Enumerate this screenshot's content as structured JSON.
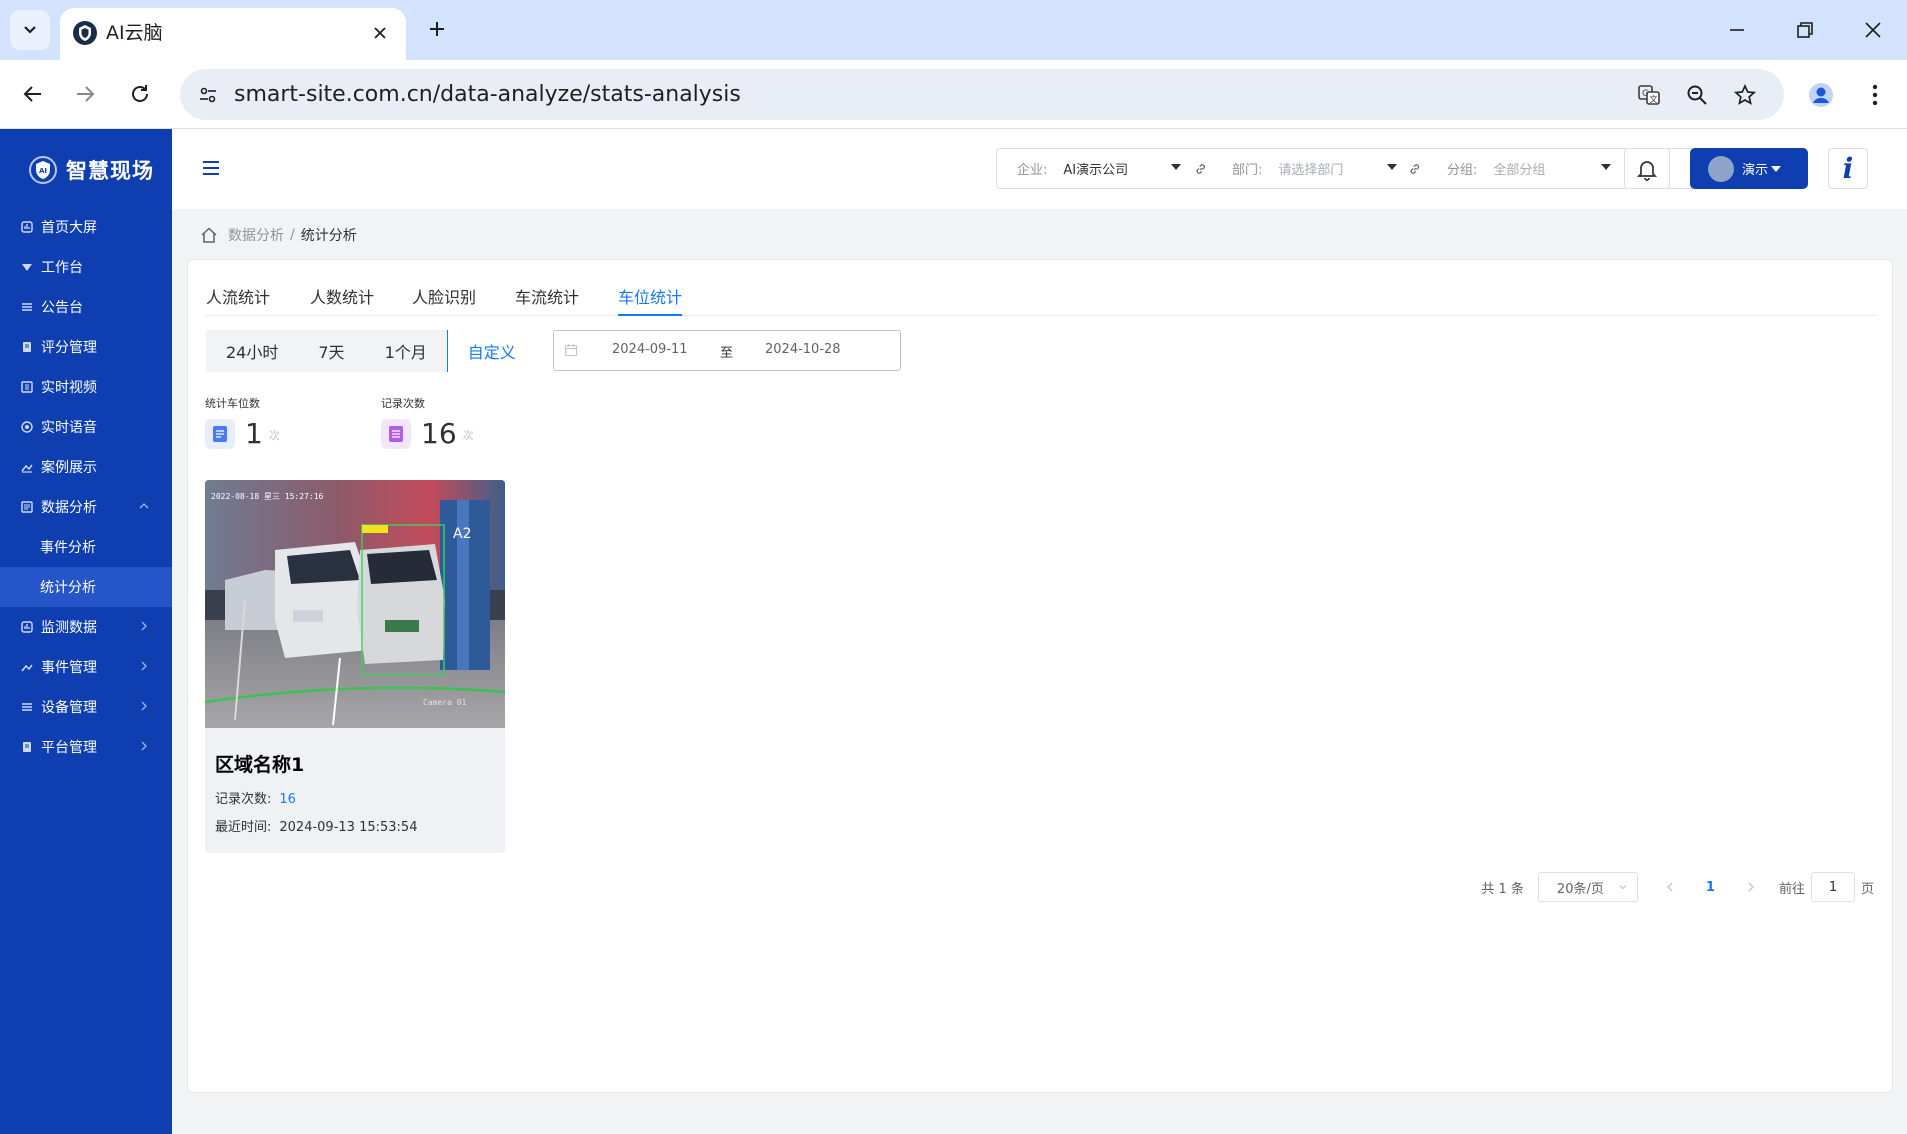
{
  "browser": {
    "tab_title": "AI云脑",
    "url": "smart-site.com.cn/data-analyze/stats-analysis"
  },
  "sidebar": {
    "brand": "智慧现场",
    "items": [
      {
        "label": "首页大屏",
        "icon": "dashboard-icon"
      },
      {
        "label": "工作台",
        "icon": "workbench-icon"
      },
      {
        "label": "公告台",
        "icon": "announcement-icon"
      },
      {
        "label": "评分管理",
        "icon": "score-icon"
      },
      {
        "label": "实时视频",
        "icon": "video-icon"
      },
      {
        "label": "实时语音",
        "icon": "voice-icon"
      },
      {
        "label": "案例展示",
        "icon": "case-icon"
      },
      {
        "label": "数据分析",
        "icon": "analysis-icon",
        "expanded": true,
        "children": [
          {
            "label": "事件分析"
          },
          {
            "label": "统计分析",
            "active": true
          }
        ]
      },
      {
        "label": "监测数据",
        "icon": "monitor-icon"
      },
      {
        "label": "事件管理",
        "icon": "event-icon"
      },
      {
        "label": "设备管理",
        "icon": "device-icon"
      },
      {
        "label": "平台管理",
        "icon": "platform-icon"
      }
    ]
  },
  "header": {
    "enterprise_label": "企业:",
    "enterprise_value": "AI演示公司",
    "department_label": "部门:",
    "department_placeholder": "请选择部门",
    "group_label": "分组:",
    "group_value": "全部分组",
    "user_label": "演示",
    "info_glyph": "i"
  },
  "breadcrumb": {
    "parent": "数据分析",
    "separator": "/",
    "current": "统计分析"
  },
  "tabs": [
    {
      "label": "人流统计"
    },
    {
      "label": "人数统计"
    },
    {
      "label": "人脸识别"
    },
    {
      "label": "车流统计"
    },
    {
      "label": "车位统计",
      "active": true
    }
  ],
  "range_buttons": [
    {
      "label": "24小时"
    },
    {
      "label": "7天"
    },
    {
      "label": "1个月"
    },
    {
      "label": "自定义",
      "active": true
    }
  ],
  "date_range": {
    "start": "2024-09-11",
    "separator": "至",
    "end": "2024-10-28"
  },
  "stats": [
    {
      "label": "统计车位数",
      "value": "1",
      "unit": "次",
      "icon": "document-icon",
      "color": "#4a7bf7"
    },
    {
      "label": "记录次数",
      "value": "16",
      "unit": "次",
      "icon": "list-icon",
      "color": "#b15de8"
    }
  ],
  "spot_card": {
    "title": "区域名称1",
    "count_label": "记录次数:",
    "count_value": "16",
    "time_label": "最近时间:",
    "time_value": "2024-09-13 15:53:54",
    "image_timestamp": "2022-08-18 星三 15:27:16",
    "image_camera": "Camera 01",
    "image_zone": "A2"
  },
  "pagination": {
    "total": "共 1 条",
    "page_size": "20条/页",
    "current_page": "1",
    "goto_label": "前往",
    "goto_value": "1",
    "page_suffix": "页"
  },
  "colors": {
    "sidebar": "#0e3eb0",
    "accent": "#1677ff",
    "page_bg": "#f2f3f5"
  }
}
